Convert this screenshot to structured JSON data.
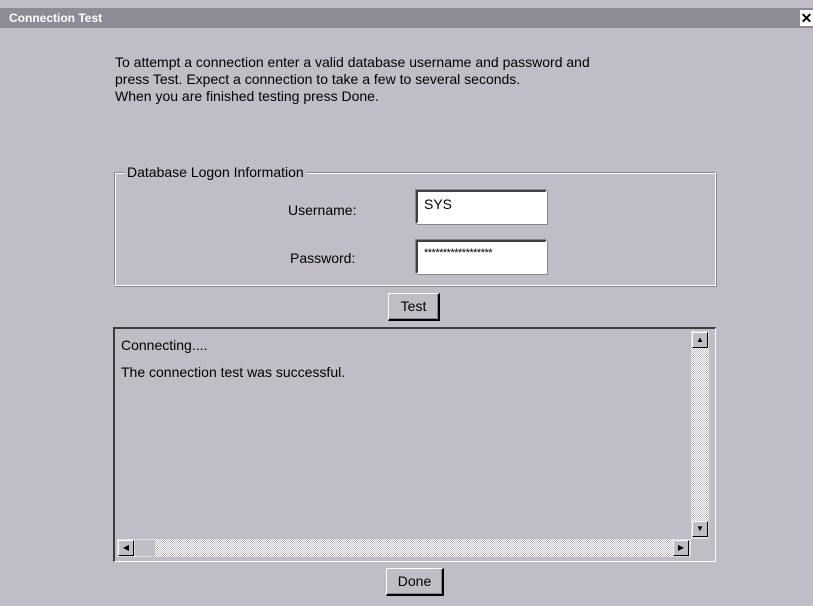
{
  "window": {
    "title": "Connection Test",
    "close_glyph": "✕"
  },
  "instructions": {
    "line1": "To attempt a connection enter a valid database username and password and",
    "line2": "press Test.  Expect a connection to take a few to several seconds.",
    "line3": "When you are finished testing press Done."
  },
  "logon": {
    "group_label": "Database Logon Information",
    "username_label": "Username:",
    "username_value": "SYS",
    "password_label": "Password:",
    "password_value": "******************"
  },
  "buttons": {
    "test_label": "Test",
    "done_label": "Done"
  },
  "output": {
    "line1": "Connecting....",
    "line2": "The connection test was successful."
  },
  "icons": {
    "scroll_up": "▲",
    "scroll_down": "▼",
    "scroll_left": "◀",
    "scroll_right": "▶"
  },
  "colors": {
    "window_bg": "#c0bdc6",
    "titlebar_bg": "#8e8a96"
  }
}
